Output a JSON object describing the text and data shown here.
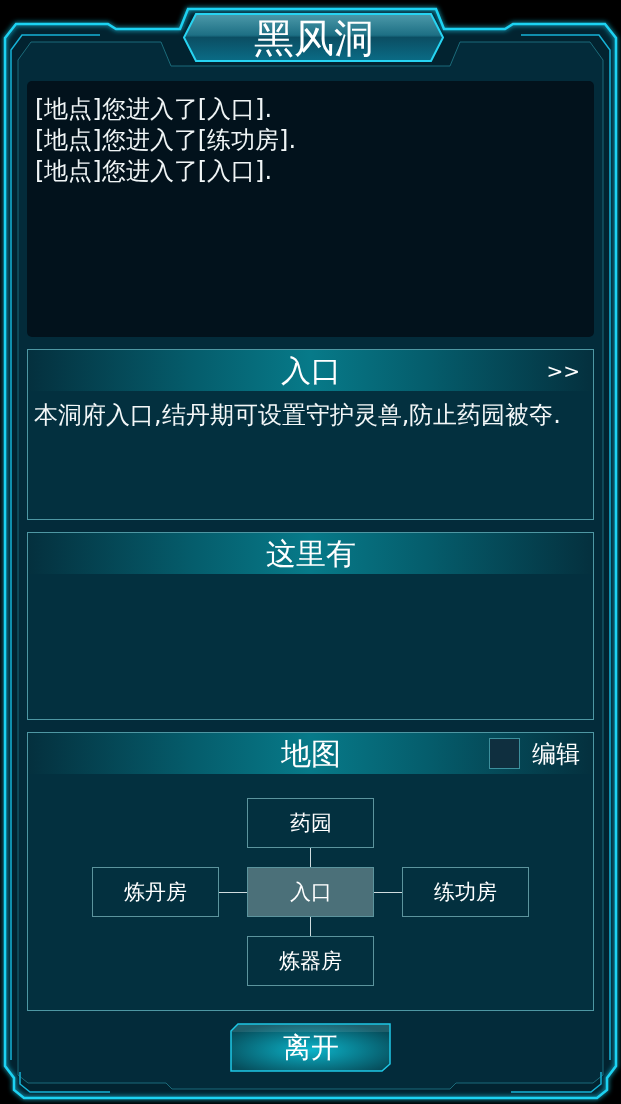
{
  "title": "黑风洞",
  "log": {
    "lines": [
      "[地点]您进入了[入口].",
      "[地点]您进入了[练功房].",
      "[地点]您进入了[入口]."
    ]
  },
  "panels": [
    {
      "kind": "description",
      "title": "入口",
      "more_button": ">>",
      "text": "本洞府入口,结丹期可设置守护灵兽,防止药园被夺."
    },
    {
      "kind": "contents",
      "title": "这里有"
    },
    {
      "kind": "map",
      "title": "地图",
      "edit": {
        "label": "编辑",
        "checked": false
      },
      "rooms": {
        "north": {
          "label": "药园",
          "selected": false
        },
        "west": {
          "label": "炼丹房",
          "selected": false
        },
        "center": {
          "label": "入口",
          "selected": true
        },
        "east": {
          "label": "练功房",
          "selected": false
        },
        "south": {
          "label": "炼器房",
          "selected": false
        }
      }
    }
  ],
  "leave_button": "离开"
}
